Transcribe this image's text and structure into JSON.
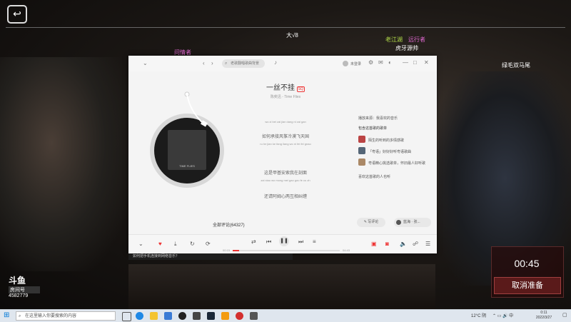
{
  "danmu": {
    "d1": "大√8",
    "d2": "老江湖",
    "d3": "远行者",
    "d4": "虎牙源帅",
    "d5": "问情者",
    "d6": "绿毛双马尾"
  },
  "player": {
    "search_placeholder": "老歌翻唱歌曲背景",
    "login_text": "未登录",
    "song": {
      "title": "一丝不挂",
      "badge": "SQ",
      "artist": "陈奕迅 - Time Flies"
    },
    "album_label": "TIME FLIES",
    "lyrics": [
      {
        "pinyin": "wo zi bei zai jian dang ni zai gan",
        "text": ""
      },
      {
        "text": "如何承接风筝冷漠飞天国",
        "pinyin": "ru he jian ke fang liang wo ni fei fei gnao"
      },
      {
        "text": "这是甲基安索我在剖面",
        "pinyin": "zai xiao wo mong mei gao gou fe cu zh"
      },
      {
        "text": "还请阿姆心两互相纠缠",
        "pinyin": ""
      }
    ],
    "side": {
      "from": "播放来源：我喜欢的音乐",
      "fans_title": "包含这首歌的歌单",
      "playlists": [
        "陌生的听到的多情感歌",
        "「粤语」好好好听粤语歌曲",
        "粤语精心挑选歌单，怀旧最人好听歌"
      ],
      "similar": "喜欢这首歌的人也听"
    },
    "comments_label": "全部评论(64327)",
    "write_comment": "写评论",
    "user_label": "蓝海 · 张...",
    "time_now": "00:15",
    "time_total": "04:43",
    "progress": 0.06
  },
  "notification": "如何把手机连接到网络音乐？",
  "overlay": {
    "timer": "00:45",
    "cancel": "取消准备"
  },
  "douyu": {
    "logo": "斗鱼",
    "room_label": "房间号",
    "room_number": "4582779"
  },
  "taskbar": {
    "search_placeholder": "在这里输入你要搜索的内容",
    "weather": "12°C 阴",
    "time": "0:11",
    "date": "2022/3/27"
  }
}
